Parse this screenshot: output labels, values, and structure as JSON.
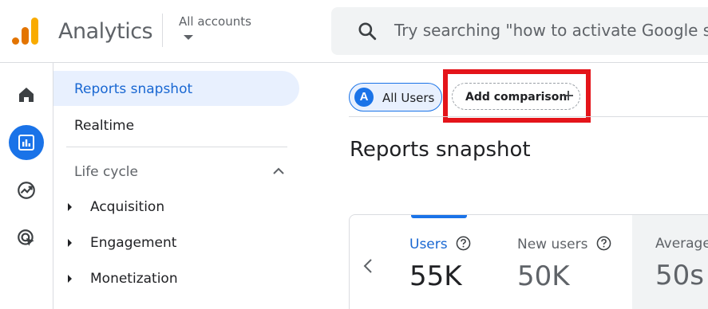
{
  "header": {
    "app_title": "Analytics",
    "accounts_label": "All accounts",
    "search_placeholder": "Try searching \"how to activate Google sig"
  },
  "rail": {
    "icons": [
      "home-icon",
      "reports-icon",
      "explore-icon",
      "advertising-icon"
    ],
    "active": "reports-icon"
  },
  "nav": {
    "active_label": "Reports snapshot",
    "realtime_label": "Realtime",
    "section_label": "Life cycle",
    "items": [
      {
        "label": "Acquisition"
      },
      {
        "label": "Engagement"
      },
      {
        "label": "Monetization"
      }
    ]
  },
  "main": {
    "segment_badge": "A",
    "segment_label": "All Users",
    "add_comparison_label": "Add comparison",
    "page_title": "Reports snapshot",
    "metrics": [
      {
        "label": "Users",
        "value": "55K"
      },
      {
        "label": "New users",
        "value": "50K"
      },
      {
        "label": "Average",
        "value": "50s"
      }
    ]
  },
  "colors": {
    "accent": "#1a73e8",
    "highlight_box": "#e4141a",
    "logo_orange": "#f9ab00",
    "logo_dark_orange": "#e37400"
  }
}
